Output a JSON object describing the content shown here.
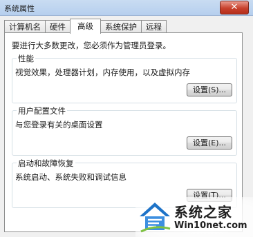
{
  "window": {
    "title": "系统属性",
    "close_label": "✕"
  },
  "tabs": [
    {
      "label": "计算机名",
      "active": false
    },
    {
      "label": "硬件",
      "active": false
    },
    {
      "label": "高级",
      "active": true
    },
    {
      "label": "系统保护",
      "active": false
    },
    {
      "label": "远程",
      "active": false
    }
  ],
  "notice": "要进行大多数更改，您必须作为管理员登录。",
  "groups": [
    {
      "title": "性能",
      "description": "视觉效果，处理器计划，内存使用，以及虚拟内存",
      "button_label": "设置(S)..."
    },
    {
      "title": "用户配置文件",
      "description": "与您登录有关的桌面设置",
      "button_label": "设置(E)..."
    },
    {
      "title": "启动和故障恢复",
      "description": "系统启动、系统失败和调试信息",
      "button_label": "设置(T)..."
    }
  ],
  "watermark": {
    "name": "系统之家",
    "site": "Win10net.com"
  }
}
